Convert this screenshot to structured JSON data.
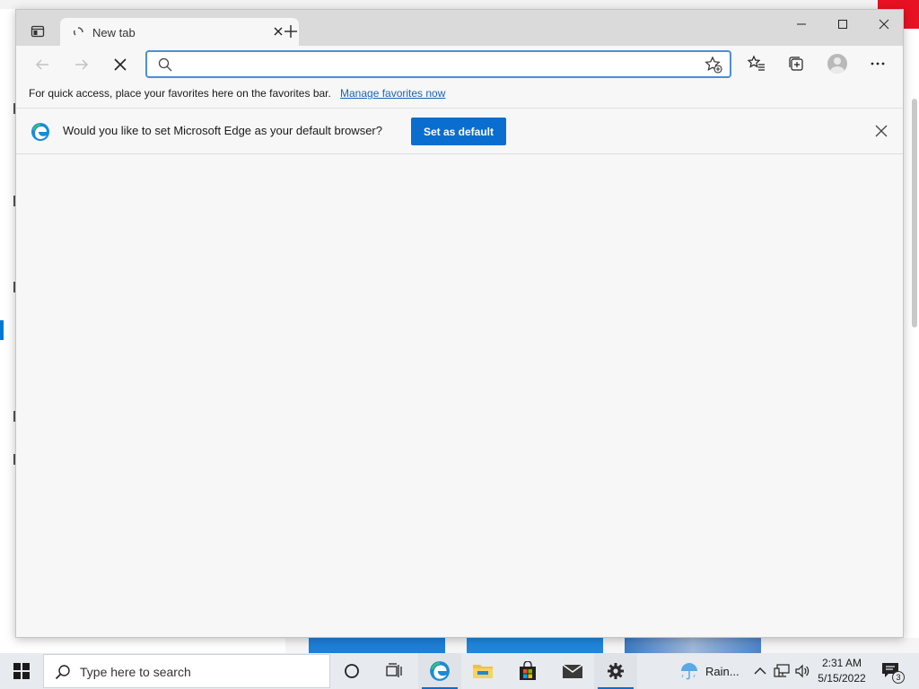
{
  "browser": {
    "tab": {
      "title": "New tab"
    },
    "address": {
      "value": "",
      "placeholder": ""
    },
    "favorites_bar": {
      "text": "For quick access, place your favorites here on the favorites bar.",
      "link": "Manage favorites now"
    },
    "infobar": {
      "message": "Would you like to set Microsoft Edge as your default browser?",
      "button": "Set as default"
    }
  },
  "taskbar": {
    "search_placeholder": "Type here to search",
    "weather": "Rain...",
    "time": "2:31 AM",
    "date": "5/15/2022",
    "notification_count": "3"
  },
  "colors": {
    "accent": "#0a6ed1",
    "close_red": "#e81123",
    "link": "#1a64b8"
  },
  "icons": [
    "tab-actions-icon",
    "loading-spinner-icon",
    "close-icon",
    "plus-icon",
    "minimize-icon",
    "maximize-icon",
    "back-arrow-icon",
    "forward-arrow-icon",
    "stop-icon",
    "search-icon",
    "add-favorite-icon",
    "favorites-icon",
    "collections-icon",
    "profile-icon",
    "more-icon",
    "edge-logo-icon",
    "windows-icon",
    "cortana-icon",
    "task-view-icon",
    "file-explorer-icon",
    "store-icon",
    "mail-icon",
    "settings-icon",
    "weather-rain-icon",
    "chevron-up-icon",
    "network-icon",
    "volume-icon",
    "notification-icon"
  ]
}
